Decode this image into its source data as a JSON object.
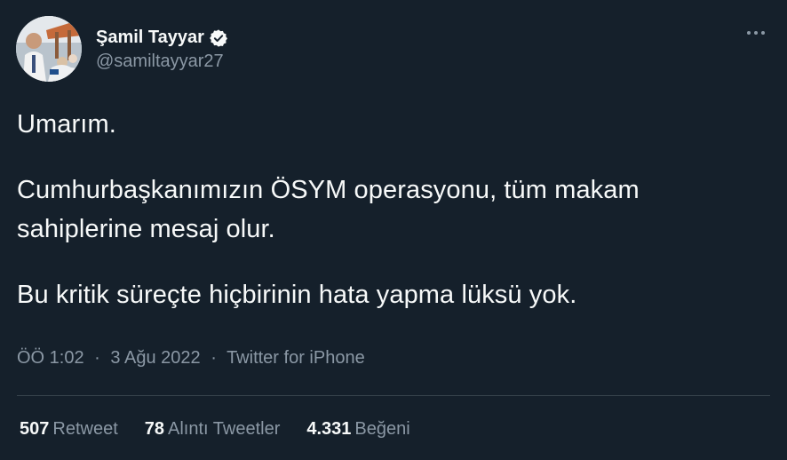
{
  "author": {
    "display_name": "Şamil Tayyar",
    "handle": "@samiltayyar27",
    "verified_icon": "verified-badge-icon",
    "avatar": "profile-photo"
  },
  "menu": {
    "icon": "more-horizontal-icon"
  },
  "tweet": {
    "paragraphs": [
      "Umarım.",
      "Cumhurbaşkanımızın ÖSYM operasyonu, tüm makam sahiplerine mesaj olur.",
      "Bu kritik süreçte hiçbirinin hata yapma lüksü yok."
    ],
    "time": "ÖÖ 1:02",
    "date": "3 Ağu 2022",
    "separator": "·",
    "source": "Twitter for iPhone"
  },
  "stats": {
    "retweets": {
      "count": "507",
      "label": "Retweet"
    },
    "quotes": {
      "count": "78",
      "label": "Alıntı Tweetler"
    },
    "likes": {
      "count": "4.331",
      "label": "Beğeni"
    }
  },
  "colors": {
    "background": "#15202b",
    "text": "#f7f9f9",
    "secondary": "#8b98a5",
    "divider": "#38444d"
  }
}
